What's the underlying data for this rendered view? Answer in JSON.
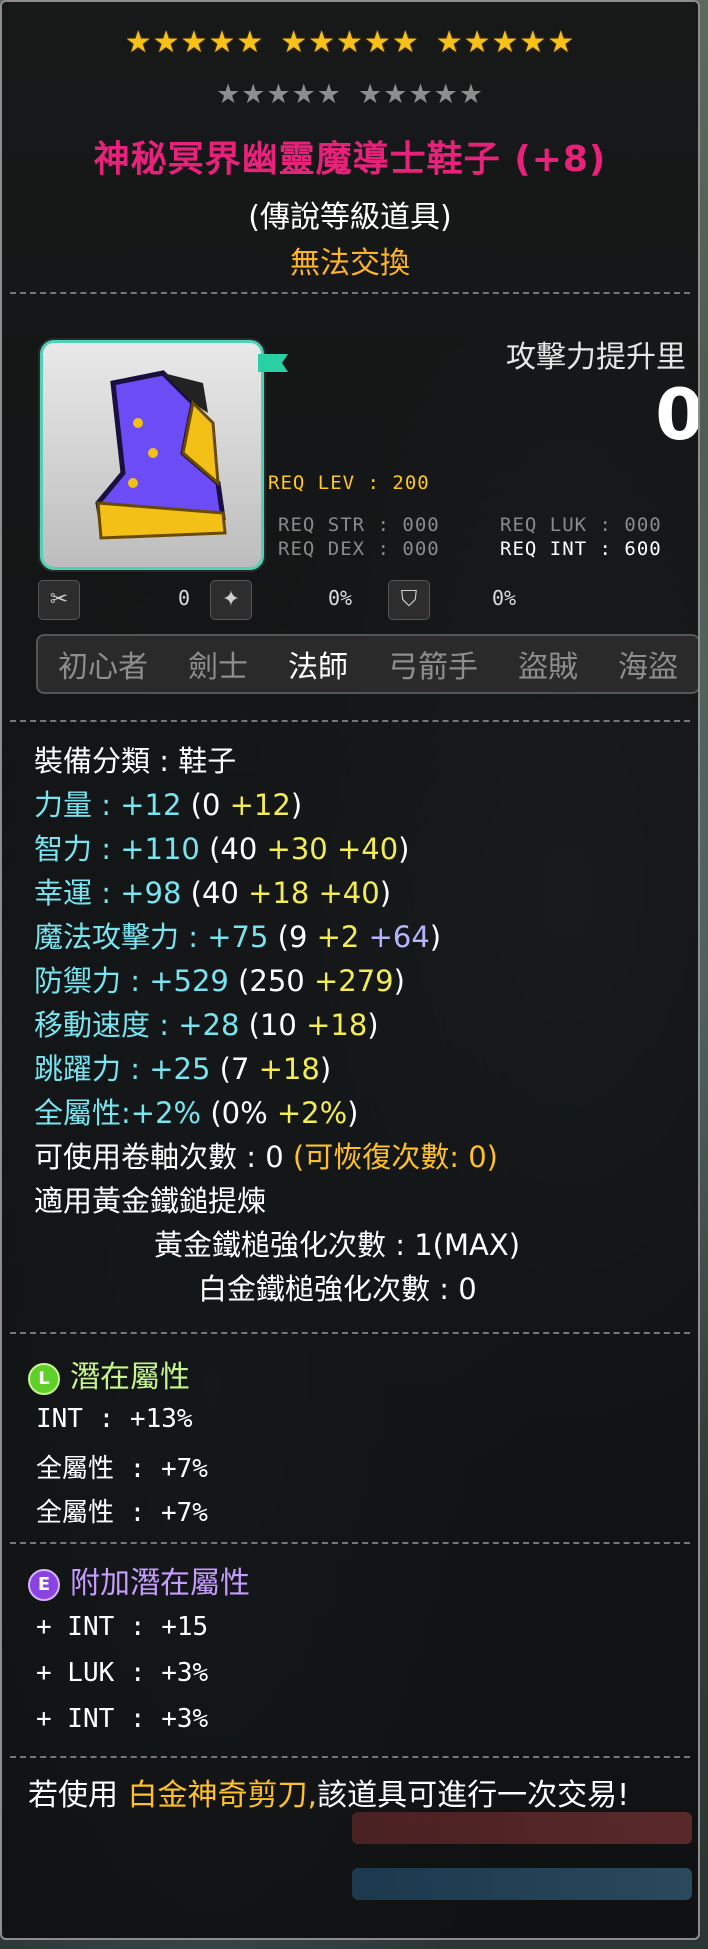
{
  "stars": {
    "gold_count": 15,
    "grey_count": 10,
    "glyph": "★"
  },
  "item": {
    "name": "神秘冥界幽靈魔導士鞋子 (+8)",
    "grade": "(傳說等級道具)",
    "trade": "無法交換",
    "icon": "boots-icon"
  },
  "attack": {
    "label": "攻擊力提升里",
    "value": "0"
  },
  "req": {
    "lev": "REQ LEV : 200",
    "str": "REQ STR : 000",
    "luk": "REQ LUK : 000",
    "dex": "REQ DEX : 000",
    "int": "REQ INT : 600"
  },
  "small_icons": [
    {
      "icon": "scissors-icon",
      "value": "0"
    },
    {
      "icon": "star-force-icon",
      "value": "0%"
    },
    {
      "icon": "shield-icon",
      "value": "0%"
    }
  ],
  "jobs": [
    {
      "label": "初心者",
      "active": false
    },
    {
      "label": "劍士",
      "active": false
    },
    {
      "label": "法師",
      "active": true
    },
    {
      "label": "弓箭手",
      "active": false
    },
    {
      "label": "盜賊",
      "active": false
    },
    {
      "label": "海盜",
      "active": false
    }
  ],
  "stats": {
    "category": "裝備分類 : 鞋子",
    "str": {
      "name": "力量 :",
      "total": "+12",
      "open": "(0 ",
      "b2": "+12",
      "close": ")"
    },
    "int": {
      "name": "智力 :",
      "total": "+110",
      "open": "(40 ",
      "b2": "+30",
      "b3": "+40",
      "close": ")"
    },
    "luk": {
      "name": "幸運 :",
      "total": "+98",
      "open": "(40 ",
      "b2": "+18",
      "b3": "+40",
      "close": ")"
    },
    "matk": {
      "name": "魔法攻擊力 :",
      "total": "+75",
      "open": "(9 ",
      "b2": "+2",
      "b3": "+64",
      "close": ")"
    },
    "def": {
      "name": "防禦力 :",
      "total": "+529",
      "open": "(250 ",
      "b2": "+279",
      "close": ")"
    },
    "speed": {
      "name": "移動速度 :",
      "total": "+28",
      "open": "(10 ",
      "b2": "+18",
      "close": ")"
    },
    "jump": {
      "name": "跳躍力 :",
      "total": "+25",
      "open": "(7 ",
      "b2": "+18",
      "close": ")"
    },
    "all": {
      "name": "全屬性:",
      "total": "+2%",
      "open": "(0% ",
      "b2": "+2%",
      "close": ")"
    },
    "scroll_a": "可使用卷軸次數 : 0 ",
    "scroll_b": "(可恢復次數: 0)",
    "hammer_title": "適用黃金鐵鎚提煉",
    "gold_hammer": "黃金鐵槌強化次數 : 1(MAX)",
    "plat_hammer": "白金鐵槌強化次數 : 0"
  },
  "potential": {
    "title": "潛在屬性",
    "icon_letter": "L",
    "lines": [
      "INT : +13%",
      "全屬性 : +7%",
      "全屬性 : +7%"
    ]
  },
  "additional": {
    "title": "附加潛在屬性",
    "icon_letter": "E",
    "lines": [
      "+ INT : +15",
      "+ LUK : +3%",
      "+ INT : +3%"
    ]
  },
  "footer": {
    "pre": "若使用 ",
    "highlight": "白金神奇剪刀,",
    "post": "該道具可進行一次交易!"
  },
  "colors": {
    "title": "#e8227b",
    "trade": "#ffb428",
    "stat_cyan": "#79e3f0",
    "bonus_yellow": "#f4ec55",
    "bonus_purple": "#b4b4ff",
    "potential_green": "#c6f58d",
    "additional_purple": "#c79cff"
  }
}
